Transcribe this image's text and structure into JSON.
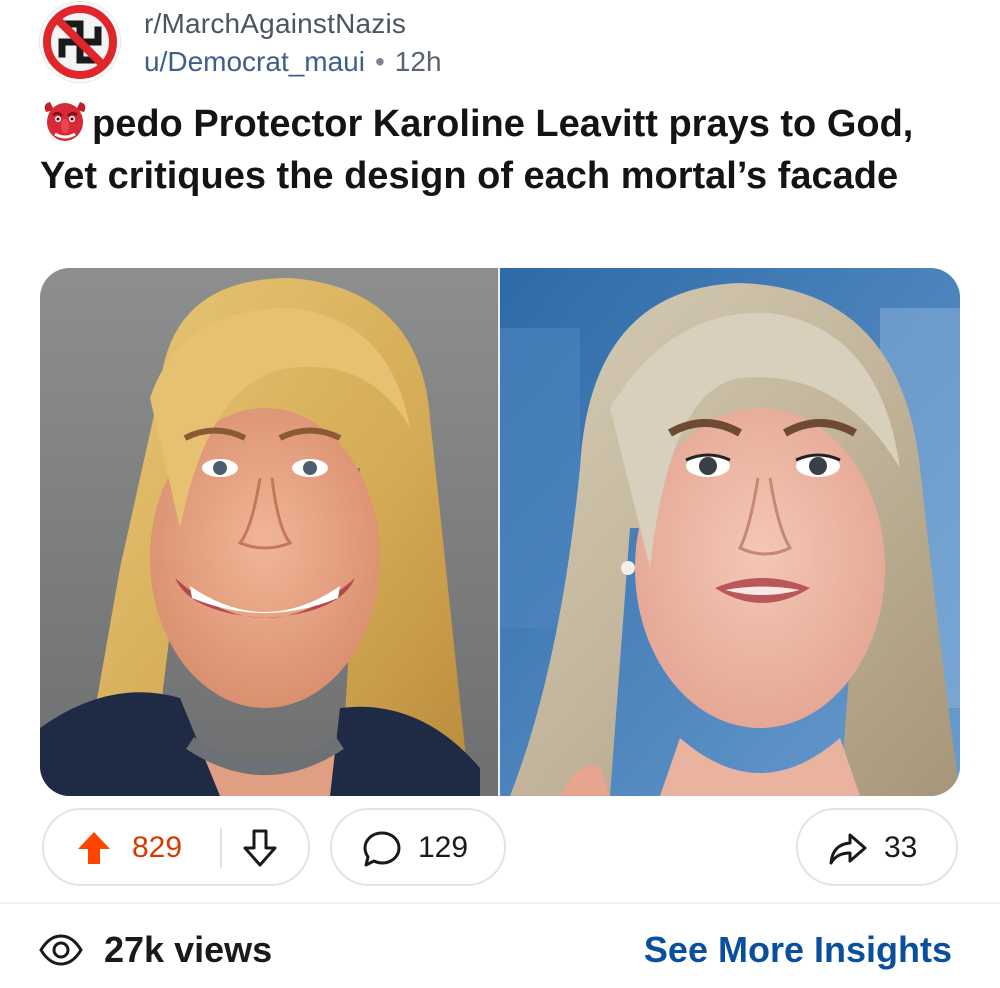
{
  "header": {
    "subreddit": "r/MarchAgainstNazis",
    "username": "u/Democrat_maui",
    "separator": "•",
    "time": "12h",
    "avatar_icon": "no-swastika-icon"
  },
  "post": {
    "title_emoji_icon": "goblin-mask-emoji",
    "title": "pedo Protector Karoline Leavitt prays to God, Yet critiques the design of each mortal’s facade"
  },
  "media": {
    "left_photo_icon": "woman-photo-before",
    "right_photo_icon": "woman-photo-after"
  },
  "actions": {
    "score": "829",
    "comments": "129",
    "shares": "33",
    "upvote_color": "#ff4500"
  },
  "footer": {
    "views": "27k views",
    "insights_link": "See More Insights",
    "link_color": "#0a4f9e"
  }
}
